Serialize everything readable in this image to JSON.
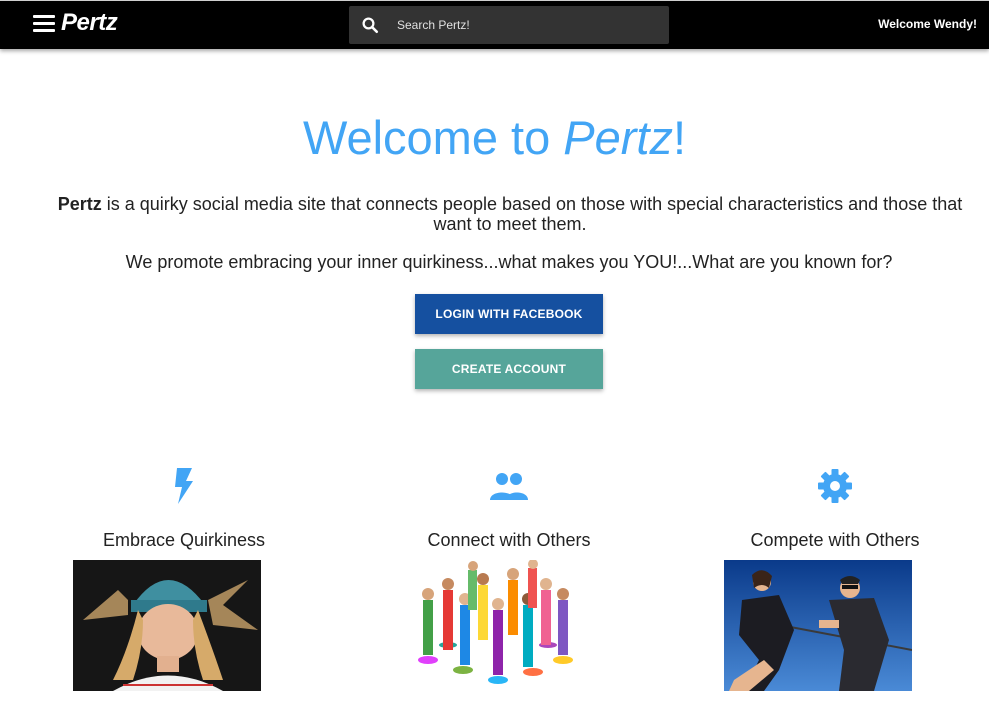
{
  "navbar": {
    "brand": "Pertz",
    "search_placeholder": "Search Pertz!",
    "welcome": "Welcome Wendy!"
  },
  "hero": {
    "title_prefix": "Welcome to ",
    "title_brand": "Pertz",
    "title_suffix": "!",
    "desc_brand": "Pertz",
    "desc_text": " is a quirky social media site that connects people based on those with special characteristics and those that want to meet them.",
    "tagline": "We promote embracing your inner quirkiness...what makes you YOU!...What are you known for?"
  },
  "buttons": {
    "facebook": "LOGIN WITH FACEBOOK",
    "create": "CREATE ACCOUNT"
  },
  "features": [
    {
      "title": "Embrace Quirkiness",
      "icon": "flash-icon"
    },
    {
      "title": "Connect with Others",
      "icon": "people-icon"
    },
    {
      "title": "Compete with Others",
      "icon": "gear-icon"
    }
  ],
  "colors": {
    "accent": "#42a5f5",
    "facebook": "#1550a0",
    "create": "#56a59a",
    "navbar": "#000000"
  }
}
